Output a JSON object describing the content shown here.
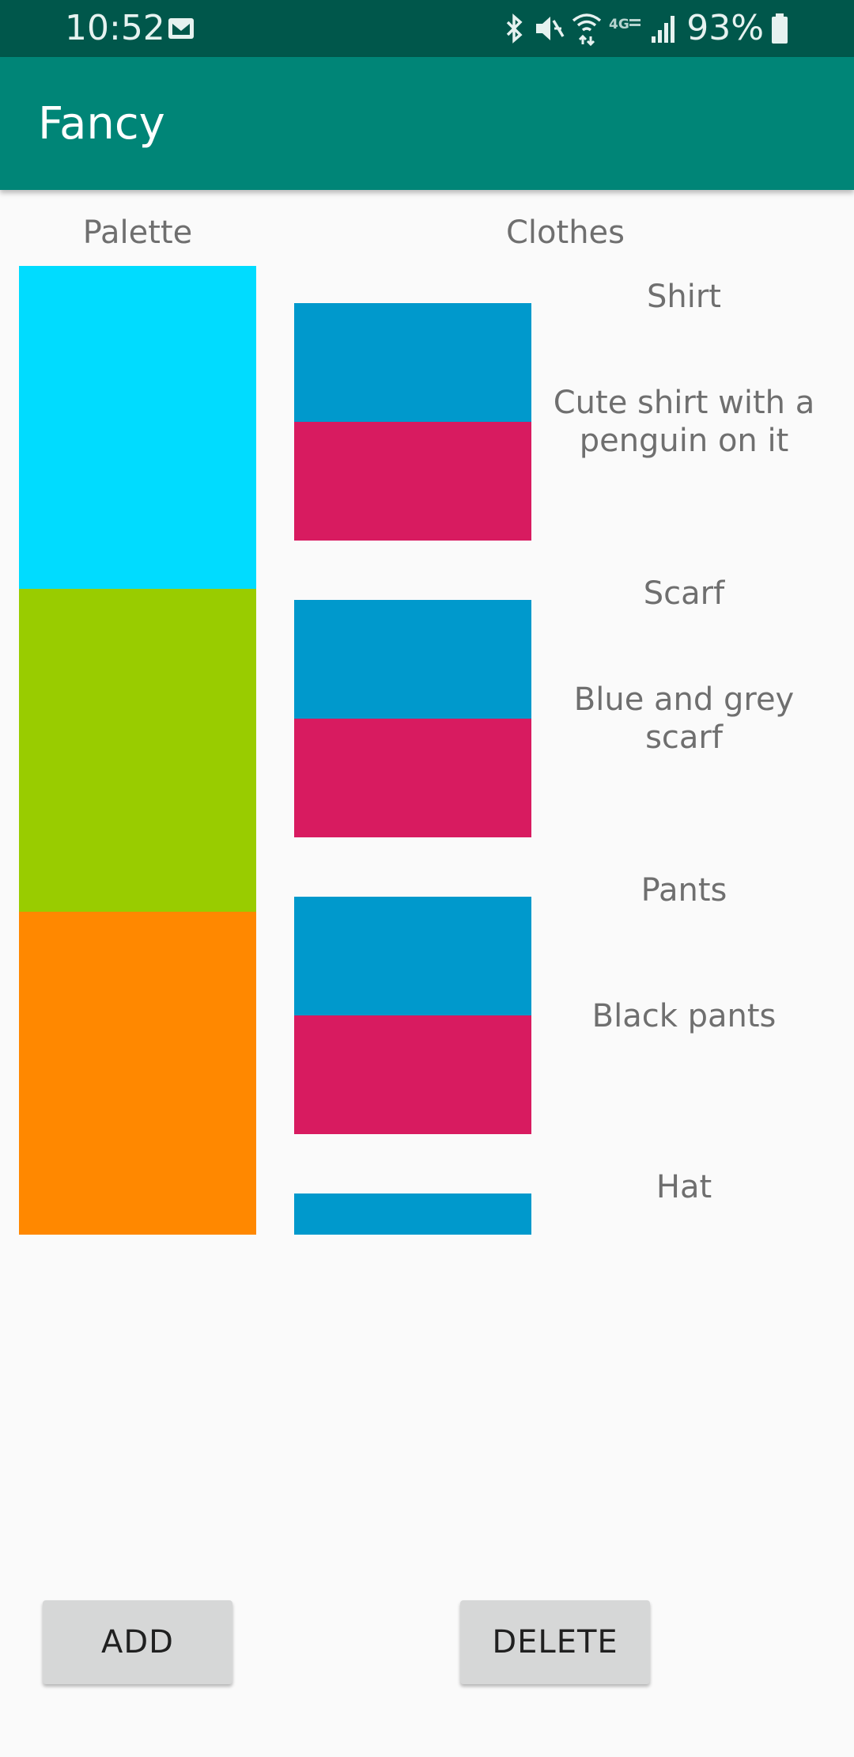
{
  "status_bar": {
    "time": "10:52",
    "battery": "93%",
    "icons": [
      "mail-icon",
      "bluetooth-icon",
      "mute-icon",
      "wifi-icon",
      "lte-icon",
      "signal-icon",
      "battery-icon"
    ]
  },
  "app_bar": {
    "title": "Fancy",
    "color": "#008577"
  },
  "headers": {
    "palette": "Palette",
    "clothes": "Clothes"
  },
  "palette": [
    {
      "color": "#00dcff"
    },
    {
      "color": "#99cc00"
    },
    {
      "color": "#ff8800"
    }
  ],
  "clothes": [
    {
      "name": "Shirt",
      "description": "Cute shirt with a penguin on it",
      "colors": [
        "#0099cc",
        "#d81b60"
      ]
    },
    {
      "name": "Scarf",
      "description": "Blue and grey scarf",
      "colors": [
        "#0099cc",
        "#d81b60"
      ]
    },
    {
      "name": "Pants",
      "description": "Black pants",
      "colors": [
        "#0099cc",
        "#d81b60"
      ]
    },
    {
      "name": "Hat",
      "colors": [
        "#0099cc"
      ]
    }
  ],
  "buttons": {
    "add": "ADD",
    "delete": "DELETE"
  }
}
